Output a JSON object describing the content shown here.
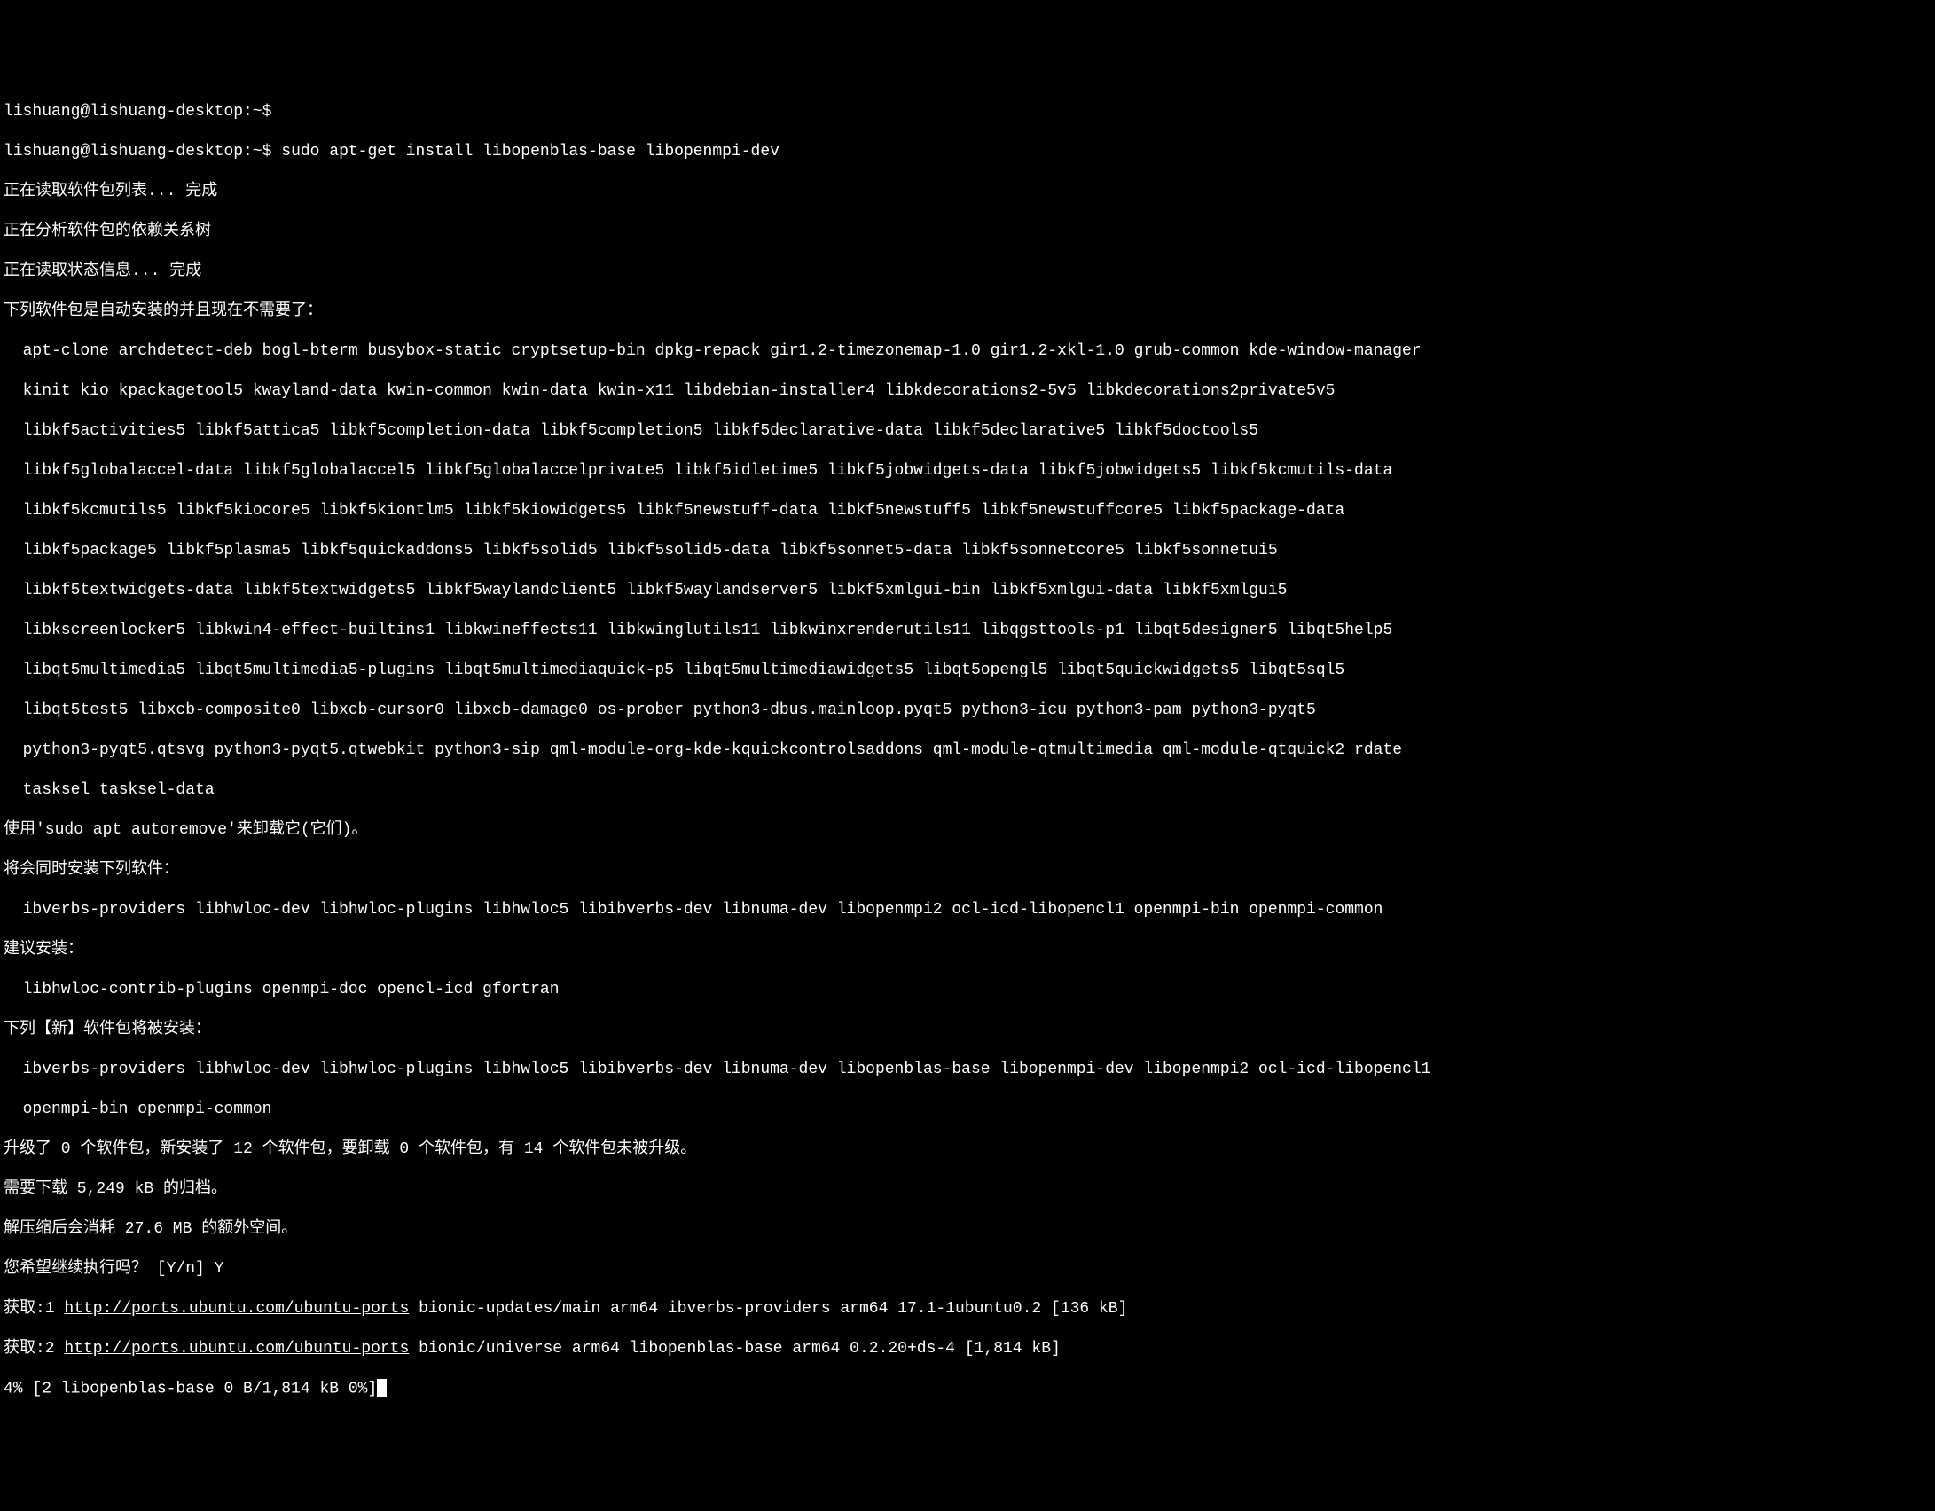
{
  "prompt_line_prev": "lishuang@lishuang-desktop:~$",
  "prompt": "lishuang@lishuang-desktop:~$ ",
  "command": "sudo apt-get install libopenblas-base libopenmpi-dev",
  "lines": {
    "reading_list": "正在读取软件包列表... 完成",
    "deps_tree": "正在分析软件包的依赖关系树",
    "reading_state": "正在读取状态信息... 完成",
    "auto_installed_header": "下列软件包是自动安装的并且现在不需要了：",
    "auto_pkg_1": "apt-clone archdetect-deb bogl-bterm busybox-static cryptsetup-bin dpkg-repack gir1.2-timezonemap-1.0 gir1.2-xkl-1.0 grub-common kde-window-manager",
    "auto_pkg_2": "kinit kio kpackagetool5 kwayland-data kwin-common kwin-data kwin-x11 libdebian-installer4 libkdecorations2-5v5 libkdecorations2private5v5",
    "auto_pkg_3": "libkf5activities5 libkf5attica5 libkf5completion-data libkf5completion5 libkf5declarative-data libkf5declarative5 libkf5doctools5",
    "auto_pkg_4": "libkf5globalaccel-data libkf5globalaccel5 libkf5globalaccelprivate5 libkf5idletime5 libkf5jobwidgets-data libkf5jobwidgets5 libkf5kcmutils-data",
    "auto_pkg_5": "libkf5kcmutils5 libkf5kiocore5 libkf5kiontlm5 libkf5kiowidgets5 libkf5newstuff-data libkf5newstuff5 libkf5newstuffcore5 libkf5package-data",
    "auto_pkg_6": "libkf5package5 libkf5plasma5 libkf5quickaddons5 libkf5solid5 libkf5solid5-data libkf5sonnet5-data libkf5sonnetcore5 libkf5sonnetui5",
    "auto_pkg_7": "libkf5textwidgets-data libkf5textwidgets5 libkf5waylandclient5 libkf5waylandserver5 libkf5xmlgui-bin libkf5xmlgui-data libkf5xmlgui5",
    "auto_pkg_8": "libkscreenlocker5 libkwin4-effect-builtins1 libkwineffects11 libkwinglutils11 libkwinxrenderutils11 libqgsttools-p1 libqt5designer5 libqt5help5",
    "auto_pkg_9": "libqt5multimedia5 libqt5multimedia5-plugins libqt5multimediaquick-p5 libqt5multimediawidgets5 libqt5opengl5 libqt5quickwidgets5 libqt5sql5",
    "auto_pkg_10": "libqt5test5 libxcb-composite0 libxcb-cursor0 libxcb-damage0 os-prober python3-dbus.mainloop.pyqt5 python3-icu python3-pam python3-pyqt5",
    "auto_pkg_11": "python3-pyqt5.qtsvg python3-pyqt5.qtwebkit python3-sip qml-module-org-kde-kquickcontrolsaddons qml-module-qtmultimedia qml-module-qtquick2 rdate",
    "auto_pkg_12": "tasksel tasksel-data",
    "autoremove_hint": "使用'sudo apt autoremove'来卸载它(它们)。",
    "extra_installed_header": "将会同时安装下列软件：",
    "extra_pkg_1": "ibverbs-providers libhwloc-dev libhwloc-plugins libhwloc5 libibverbs-dev libnuma-dev libopenmpi2 ocl-icd-libopencl1 openmpi-bin openmpi-common",
    "suggested_header": "建议安装：",
    "suggested_pkg_1": "libhwloc-contrib-plugins openmpi-doc opencl-icd gfortran",
    "new_installed_header": "下列【新】软件包将被安装：",
    "new_pkg_1": "ibverbs-providers libhwloc-dev libhwloc-plugins libhwloc5 libibverbs-dev libnuma-dev libopenblas-base libopenmpi-dev libopenmpi2 ocl-icd-libopencl1",
    "new_pkg_2": "openmpi-bin openmpi-common",
    "upgrade_summary": "升级了 0 个软件包，新安装了 12 个软件包，要卸载 0 个软件包，有 14 个软件包未被升级。",
    "download_size": "需要下载 5,249 kB 的归档。",
    "disk_space": "解压缩后会消耗 27.6 MB 的额外空间。",
    "continue_prompt": "您希望继续执行吗？ [Y/n] Y",
    "get1_prefix": "获取:1 ",
    "get1_url": "http://ports.ubuntu.com/ubuntu-ports",
    "get1_suffix": " bionic-updates/main arm64 ibverbs-providers arm64 17.1-1ubuntu0.2 [136 kB]",
    "get2_prefix": "获取:2 ",
    "get2_url": "http://ports.ubuntu.com/ubuntu-ports",
    "get2_suffix": " bionic/universe arm64 libopenblas-base arm64 0.2.20+ds-4 [1,814 kB]",
    "progress": "4% [2 libopenblas-base 0 B/1,814 kB 0%]"
  }
}
